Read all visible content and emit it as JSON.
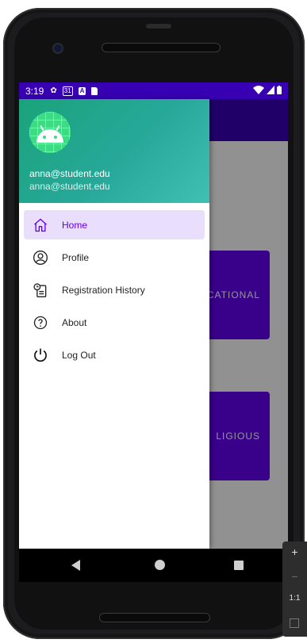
{
  "status_bar": {
    "time": "3:19",
    "icons": [
      "gear-icon",
      "calendar-icon",
      "a-icon",
      "sd-card-icon"
    ],
    "calendar_text": "31",
    "right_icons": [
      "wifi-icon",
      "signal-icon",
      "battery-icon"
    ]
  },
  "drawer": {
    "header": {
      "name": "anna@student.edu",
      "email": "anna@student.edu"
    },
    "items": [
      {
        "label": "Home",
        "icon": "home-icon",
        "active": true
      },
      {
        "label": "Profile",
        "icon": "account-circle-icon",
        "active": false
      },
      {
        "label": "Registration History",
        "icon": "history-clipboard-icon",
        "active": false
      },
      {
        "label": "About",
        "icon": "help-circle-icon",
        "active": false
      },
      {
        "label": "Log Out",
        "icon": "power-icon",
        "active": false
      }
    ]
  },
  "background": {
    "cards": [
      {
        "label": "CATIONAL"
      },
      {
        "label": "LIGIOUS"
      }
    ]
  },
  "emulator_toolbar": {
    "zoom_in": "+",
    "zoom_out": "−",
    "ratio": "1:1"
  },
  "colors": {
    "primary": "#6200ee",
    "primary_dark": "#3700b3",
    "header_teal": "#27a89a",
    "active_item_bg": "#e9defb"
  }
}
